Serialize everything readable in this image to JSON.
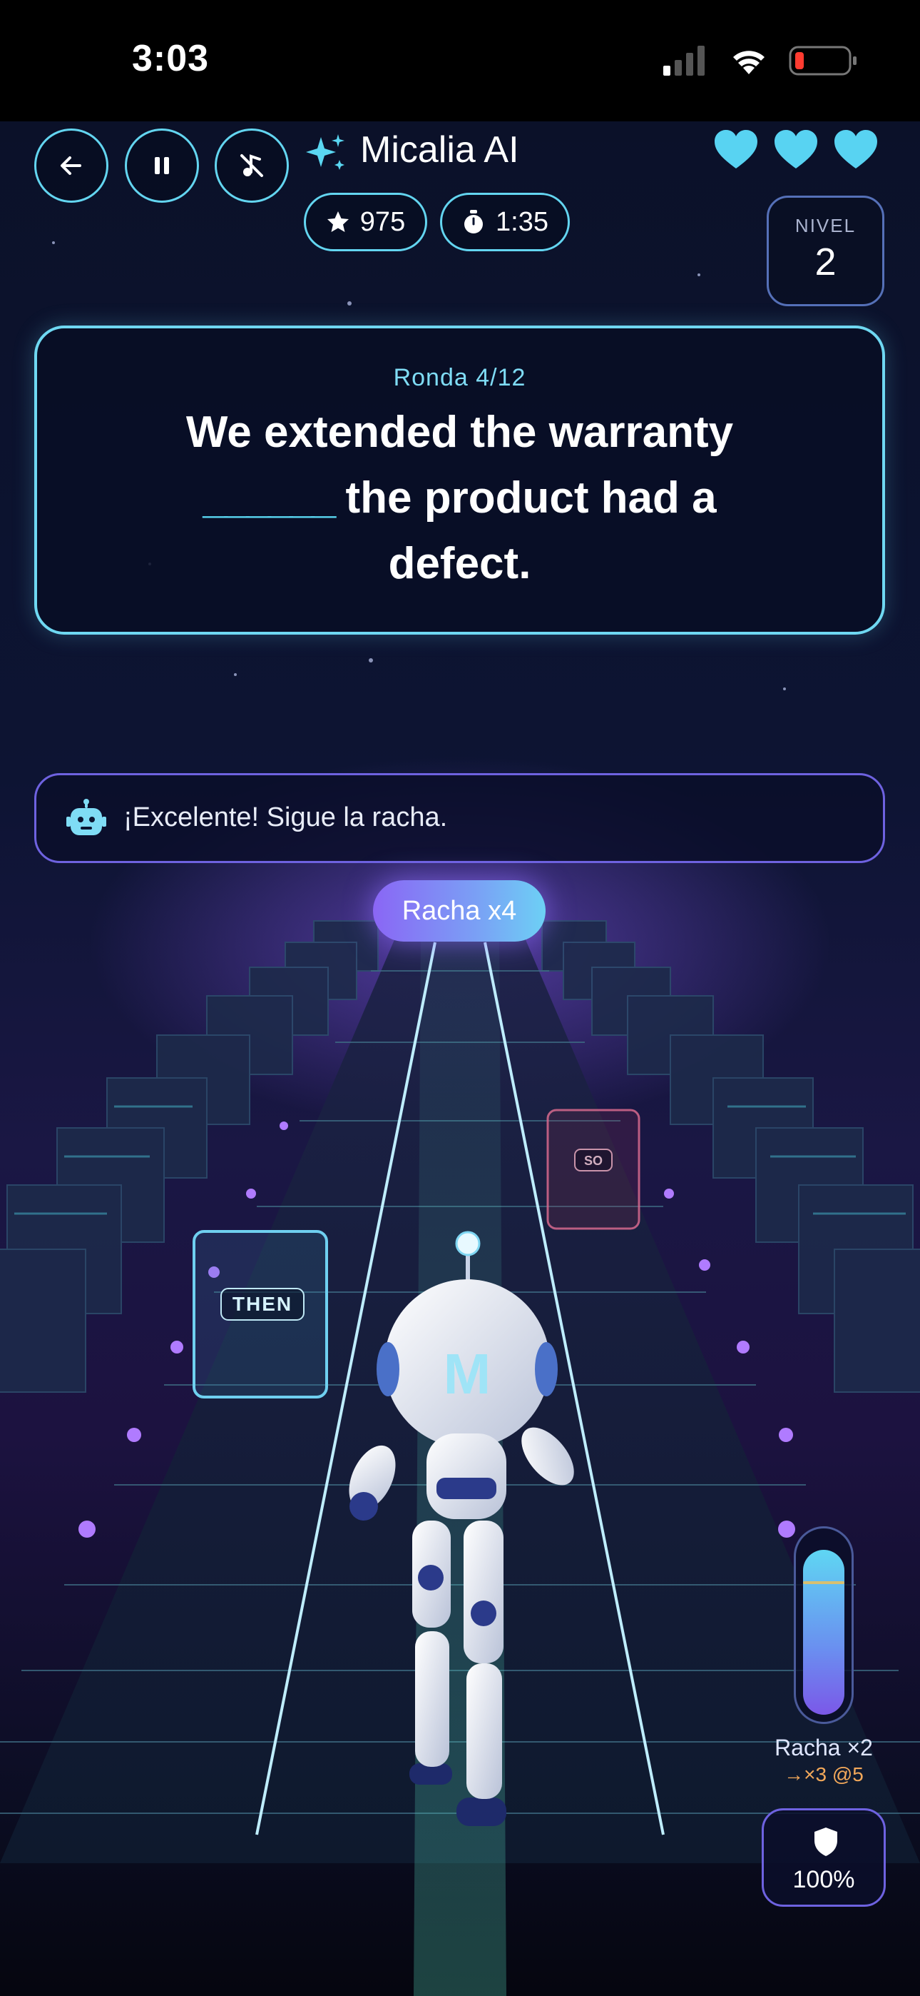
{
  "status_bar": {
    "time": "3:03"
  },
  "header": {
    "title": "Micalia AI",
    "back_icon": "arrow-left-icon",
    "pause_icon": "pause-icon",
    "mute_icon": "music-off-icon",
    "lives": 3,
    "score": "975",
    "timer": "1:35",
    "level_label": "NIVEL",
    "level_value": "2"
  },
  "question": {
    "round": "Ronda 4/12",
    "line1": "We extended the warranty",
    "blank": "______",
    "line2": " the product had a",
    "line3": "defect."
  },
  "coach": {
    "icon": "robot-icon",
    "message": "¡Excelente! Sigue la racha."
  },
  "streak_badge": "Racha x4",
  "lanes": {
    "left_option": "THEN",
    "right_option": "SO",
    "player_letter": "M"
  },
  "meter": {
    "fill_fraction": 0.92,
    "mark_fraction": 0.73,
    "multiplier": "Racha ×2",
    "next": "→×3 @5"
  },
  "shield": {
    "icon": "shield-icon",
    "value": "100%"
  },
  "colors": {
    "accent_cyan": "#63d5f0",
    "accent_purple": "#7b58e8",
    "heart": "#58d3f2",
    "warning": "#f2a85a"
  }
}
